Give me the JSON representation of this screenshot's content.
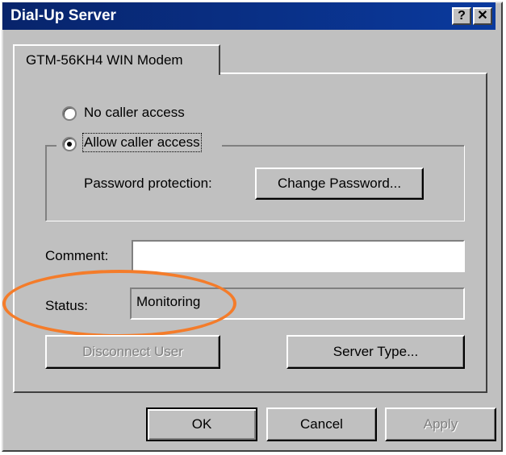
{
  "window": {
    "title": "Dial-Up Server",
    "help_label": "?",
    "close_label": "✕"
  },
  "tab": {
    "label": "GTM-56KH4 WIN Modem"
  },
  "access": {
    "no_access_label": "No caller access",
    "allow_access_label": "Allow caller access",
    "selected": "allow"
  },
  "password": {
    "label": "Password protection:",
    "button_label": "Change Password..."
  },
  "comment": {
    "label": "Comment:",
    "value": ""
  },
  "status": {
    "label": "Status:",
    "value": "Monitoring"
  },
  "buttons": {
    "disconnect": "Disconnect User",
    "server_type": "Server Type...",
    "ok": "OK",
    "cancel": "Cancel",
    "apply": "Apply"
  },
  "colors": {
    "titlebar": "#0a3a9e",
    "highlight_ellipse": "#f47c2a",
    "face": "#c0c0c0"
  }
}
